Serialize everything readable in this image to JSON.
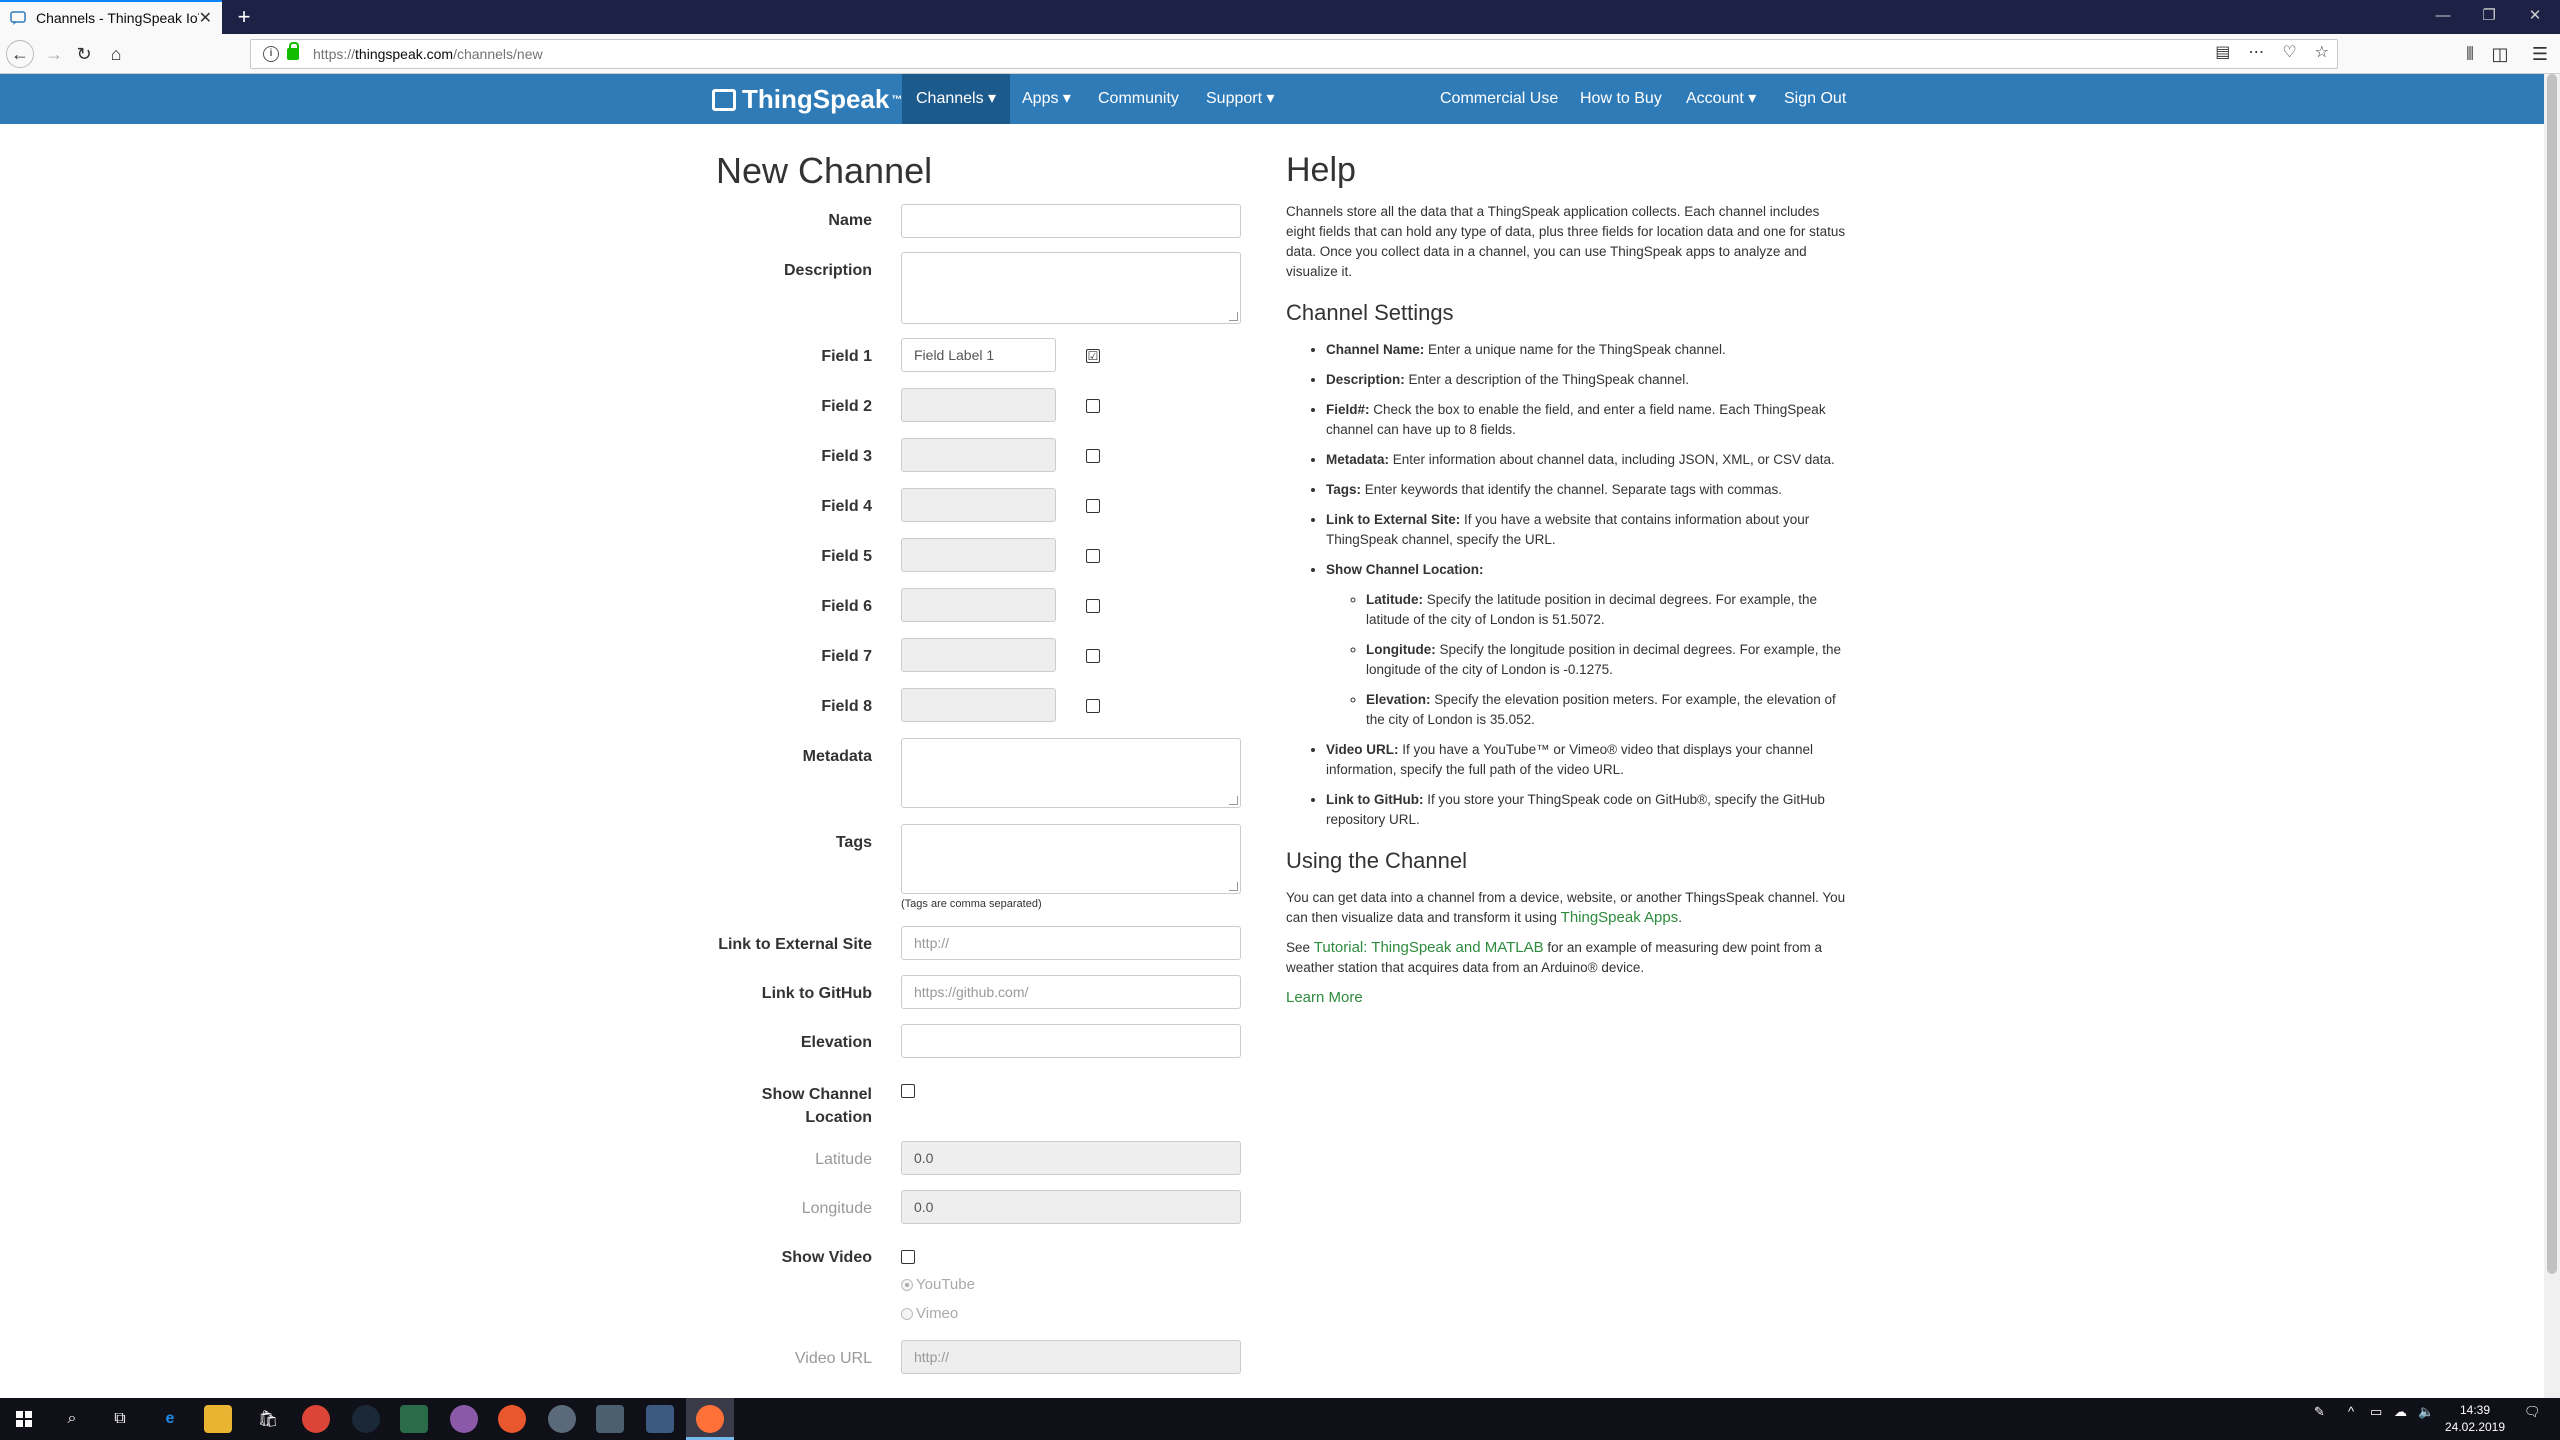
{
  "browser": {
    "tab_title": "Channels - ThingSpeak IoT",
    "tab_close": "✕",
    "new_tab": "+",
    "url_prefix": "https://",
    "url_domain": "thingspeak.com",
    "url_path": "/channels/new",
    "window_minimize": "—",
    "window_restore": "❐",
    "window_close": "✕"
  },
  "site": {
    "logo": "ThingSpeak",
    "logo_tm": "™",
    "nav": {
      "channels": "Channels ▾",
      "apps": "Apps ▾",
      "community": "Community",
      "support": "Support ▾",
      "commercial": "Commercial Use",
      "how_to_buy": "How to Buy",
      "account": "Account ▾",
      "sign_out": "Sign Out"
    }
  },
  "form": {
    "title": "New Channel",
    "name_label": "Name",
    "description_label": "Description",
    "fields": [
      {
        "label": "Field 1",
        "value": "Field Label 1",
        "checked": "☑"
      },
      {
        "label": "Field 2",
        "value": "",
        "checked": ""
      },
      {
        "label": "Field 3",
        "value": "",
        "checked": ""
      },
      {
        "label": "Field 4",
        "value": "",
        "checked": ""
      },
      {
        "label": "Field 5",
        "value": "",
        "checked": ""
      },
      {
        "label": "Field 6",
        "value": "",
        "checked": ""
      },
      {
        "label": "Field 7",
        "value": "",
        "checked": ""
      },
      {
        "label": "Field 8",
        "value": "",
        "checked": ""
      }
    ],
    "metadata_label": "Metadata",
    "tags_label": "Tags",
    "tags_hint": "(Tags are comma separated)",
    "external_label": "Link to External Site",
    "external_placeholder": "http://",
    "github_label": "Link to GitHub",
    "github_placeholder": "https://github.com/",
    "elevation_label": "Elevation",
    "show_location_label_1": "Show Channel",
    "show_location_label_2": "Location",
    "latitude_label": "Latitude",
    "latitude_value": "0.0",
    "longitude_label": "Longitude",
    "longitude_value": "0.0",
    "show_video_label": "Show Video",
    "youtube_label": "YouTube",
    "vimeo_label": "Vimeo",
    "video_url_label": "Video URL",
    "video_url_placeholder": "http://"
  },
  "help": {
    "title": "Help",
    "intro": "Channels store all the data that a ThingSpeak application collects. Each channel includes eight fields that can hold any type of data, plus three fields for location data and one for status data. Once you collect data in a channel, you can use ThingSpeak apps to analyze and visualize it.",
    "settings_title": "Channel Settings",
    "items": [
      {
        "term": "Channel Name:",
        "text": " Enter a unique name for the ThingSpeak channel."
      },
      {
        "term": "Description:",
        "text": " Enter a description of the ThingSpeak channel."
      },
      {
        "term": "Field#:",
        "text": " Check the box to enable the field, and enter a field name. Each ThingSpeak channel can have up to 8 fields."
      },
      {
        "term": "Metadata:",
        "text": " Enter information about channel data, including JSON, XML, or CSV data."
      },
      {
        "term": "Tags:",
        "text": " Enter keywords that identify the channel. Separate tags with commas."
      },
      {
        "term": "Link to External Site:",
        "text": " If you have a website that contains information about your ThingSpeak channel, specify the URL."
      },
      {
        "term": "Show Channel Location:",
        "text": ""
      }
    ],
    "location_items": [
      {
        "term": "Latitude:",
        "text": " Specify the latitude position in decimal degrees. For example, the latitude of the city of London is 51.5072."
      },
      {
        "term": "Longitude:",
        "text": " Specify the longitude position in decimal degrees. For example, the longitude of the city of London is -0.1275."
      },
      {
        "term": "Elevation:",
        "text": " Specify the elevation position meters. For example, the elevation of the city of London is 35.052."
      }
    ],
    "video_item": {
      "term": "Video URL:",
      "text": " If you have a YouTube™ or Vimeo® video that displays your channel information, specify the full path of the video URL."
    },
    "github_item": {
      "term": "Link to GitHub:",
      "text": " If you store your ThingSpeak code on GitHub®, specify the GitHub repository URL."
    },
    "using_title": "Using the Channel",
    "using_text": "You can get data into a channel from a device, website, or another ThingsSpeak channel. You can then visualize data and transform it using ",
    "using_link": "ThingSpeak Apps",
    "using_end": ".",
    "see_prefix": "See ",
    "see_link": "Tutorial: ThingSpeak and MATLAB",
    "see_suffix": " for an example of measuring dew point from a weather station that acquires data from an Arduino® device.",
    "learn_more": "Learn More"
  },
  "taskbar": {
    "time": "14:39",
    "date": "24.02.2019"
  }
}
